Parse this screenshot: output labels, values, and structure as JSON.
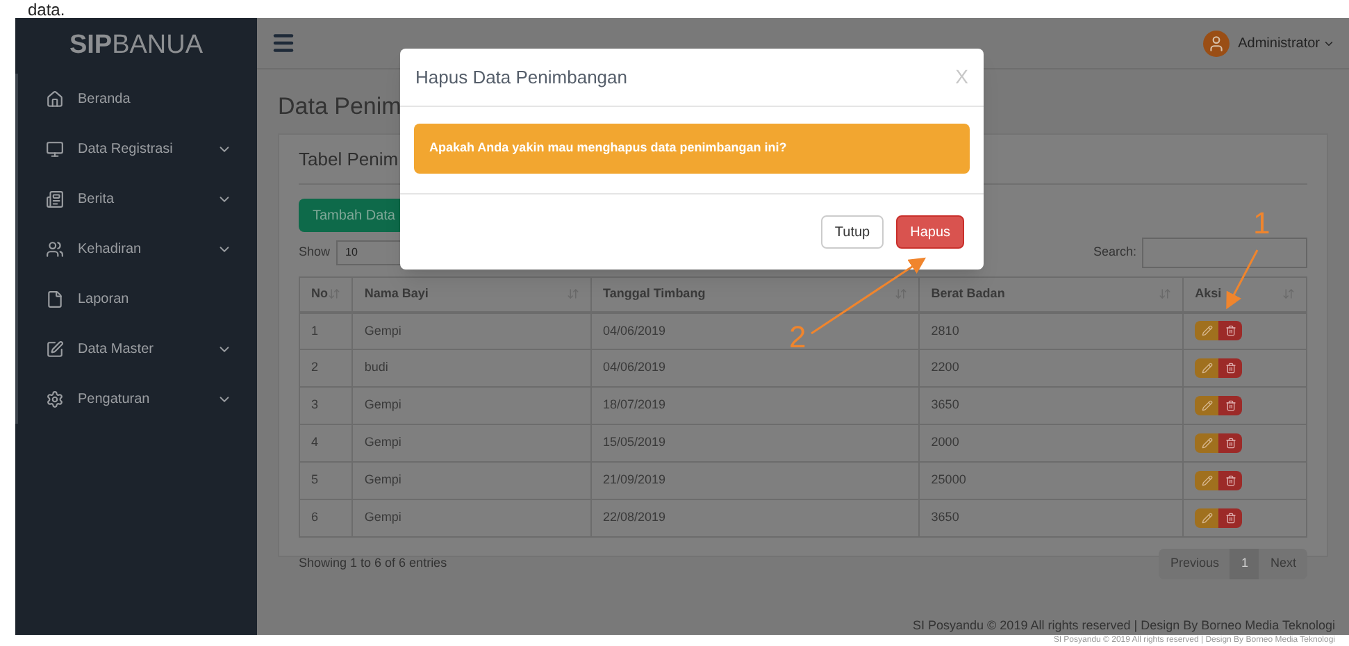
{
  "caption_fragment": "data.",
  "sidebar": {
    "brand_bold": "SIP",
    "brand_rest": "BANUA",
    "items": [
      {
        "kind": "home",
        "label": "Beranda",
        "expandable": false
      },
      {
        "kind": "monitor",
        "label": "Data Registrasi",
        "expandable": true
      },
      {
        "kind": "news",
        "label": "Berita",
        "expandable": true
      },
      {
        "kind": "users",
        "label": "Kehadiran",
        "expandable": true
      },
      {
        "kind": "file",
        "label": "Laporan",
        "expandable": false
      },
      {
        "kind": "edit",
        "label": "Data Master",
        "expandable": true
      },
      {
        "kind": "gear",
        "label": "Pengaturan",
        "expandable": true
      }
    ]
  },
  "navbar": {
    "user": "Administrator"
  },
  "page_title": "Data Penim",
  "card": {
    "title": "Tabel Penim",
    "add_button": "Tambah Data",
    "show_label": "Show",
    "page_size": "10",
    "search_label": "Search:",
    "table": {
      "columns": [
        "No",
        "Nama Bayi",
        "Tanggal Timbang",
        "Berat Badan",
        "Aksi"
      ],
      "rows": [
        [
          "1",
          "Gempi",
          "04/06/2019",
          "2810"
        ],
        [
          "2",
          "budi",
          "04/06/2019",
          "2200"
        ],
        [
          "3",
          "Gempi",
          "18/07/2019",
          "3650"
        ],
        [
          "4",
          "Gempi",
          "15/05/2019",
          "2000"
        ],
        [
          "5",
          "Gempi",
          "21/09/2019",
          "25000"
        ],
        [
          "6",
          "Gempi",
          "22/08/2019",
          "3650"
        ]
      ]
    },
    "info": "Showing 1 to 6 of 6 entries",
    "pagination": [
      {
        "label": "Previous",
        "selected": false
      },
      {
        "label": "1",
        "selected": true
      },
      {
        "label": "Next",
        "selected": false
      }
    ]
  },
  "footer": "SI Posyandu © 2019 All rights reserved | Design By Borneo Media Teknologi",
  "footer_echo": "SI Posyandu © 2019 All rights reserved | Design By Borneo Media Teknologi",
  "modal": {
    "title": "Hapus Data Penimbangan",
    "close": "X",
    "message": "Apakah Anda yakin mau menghapus data penimbangan ini?",
    "buttons": [
      {
        "kind": "default",
        "label": "Tutup"
      },
      {
        "kind": "danger",
        "label": "Hapus"
      }
    ]
  },
  "annotations": [
    "1",
    "2"
  ]
}
